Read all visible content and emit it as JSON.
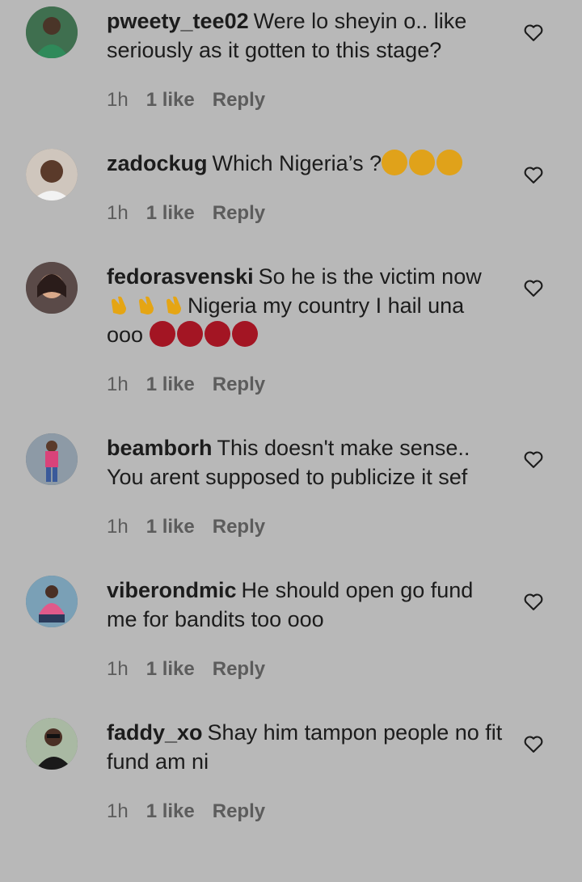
{
  "comments": [
    {
      "username": "pweety_tee02",
      "text": "Were lo sheyin o.. like seriously as it gotten to this stage?",
      "time": "1h",
      "likes": "1 like",
      "reply": "Reply",
      "avatar_color": "#3f6f4f"
    },
    {
      "username": "zadockug",
      "text": "Which Nigeria’s ?",
      "emoji": [
        "laugh",
        "laugh",
        "laugh"
      ],
      "time": "1h",
      "likes": "1 like",
      "reply": "Reply",
      "avatar_color": "#9a8a7a"
    },
    {
      "username": "fedorasvenski",
      "text_a": "So he is the victim now",
      "text_b": "Nigeria my country I hail una",
      "text_c": "ooo",
      "emoji_a": [
        "clap",
        "clap",
        "clap"
      ],
      "emoji_b": [
        "angry",
        "angry",
        "angry",
        "angry"
      ],
      "time": "1h",
      "likes": "1 like",
      "reply": "Reply",
      "avatar_color": "#5a4a48"
    },
    {
      "username": "beamborh",
      "text": "This doesn't make sense.. You arent supposed to publicize it sef",
      "time": "1h",
      "likes": "1 like",
      "reply": "Reply",
      "avatar_color": "#8d9aa6"
    },
    {
      "username": "viberondmic",
      "text": "He should open go fund me for bandits too ooo",
      "time": "1h",
      "likes": "1 like",
      "reply": "Reply",
      "avatar_color": "#7aa0b6"
    },
    {
      "username": "faddy_xo",
      "text": "Shay him tampon people no fit fund am ni",
      "time": "1h",
      "likes": "1 like",
      "reply": "Reply",
      "avatar_color": "#a9b9a3"
    }
  ]
}
